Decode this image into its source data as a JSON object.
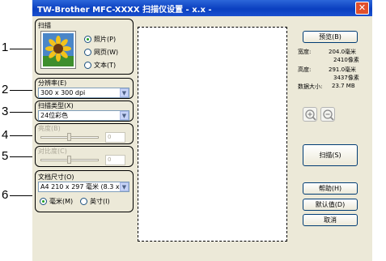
{
  "window": {
    "title": "TW-Brother MFC-XXXX   扫描仪设置 - x.x -",
    "close_glyph": "✕"
  },
  "callouts": [
    "1",
    "2",
    "3",
    "4",
    "5",
    "6"
  ],
  "scan_group": {
    "label": "扫描",
    "options": [
      "照片(P)",
      "网页(W)",
      "文本(T)"
    ],
    "selected_index": 0
  },
  "resolution": {
    "label": "分辨率(E)",
    "value": "300 x 300 dpi"
  },
  "scan_type": {
    "label": "扫描类型(X)",
    "value": "24位彩色"
  },
  "brightness": {
    "label": "亮度(B)",
    "value": "0"
  },
  "contrast": {
    "label": "对比度(C)",
    "value": "0"
  },
  "doc_size": {
    "label": "文档尺寸(O)",
    "value": "A4 210 x 297 毫米 (8.3 x 11",
    "units": [
      "毫米(M)",
      "英寸(I)"
    ],
    "selected_unit": 0
  },
  "buttons": {
    "preview": "预览(B)",
    "scan": "扫描(S)",
    "help": "帮助(H)",
    "default": "默认值(D)",
    "cancel": "取消"
  },
  "info": {
    "width_label": "宽度:",
    "width_mm": "204.0毫米",
    "width_px": "2410像素",
    "height_label": "高度:",
    "height_mm": "291.0毫米",
    "height_px": "3437像素",
    "size_label": "数据大小:",
    "size_value": "23.7 MB"
  },
  "icons": {
    "zoom_in": "zoom-in-icon",
    "zoom_out": "zoom-out-icon",
    "photo": "sunflower-photo-icon"
  },
  "colors": {
    "titlebar": "#0a3fc0",
    "window_bg": "#ece9d8",
    "close_btn": "#e0502c",
    "radio_dot": "#21a121"
  }
}
